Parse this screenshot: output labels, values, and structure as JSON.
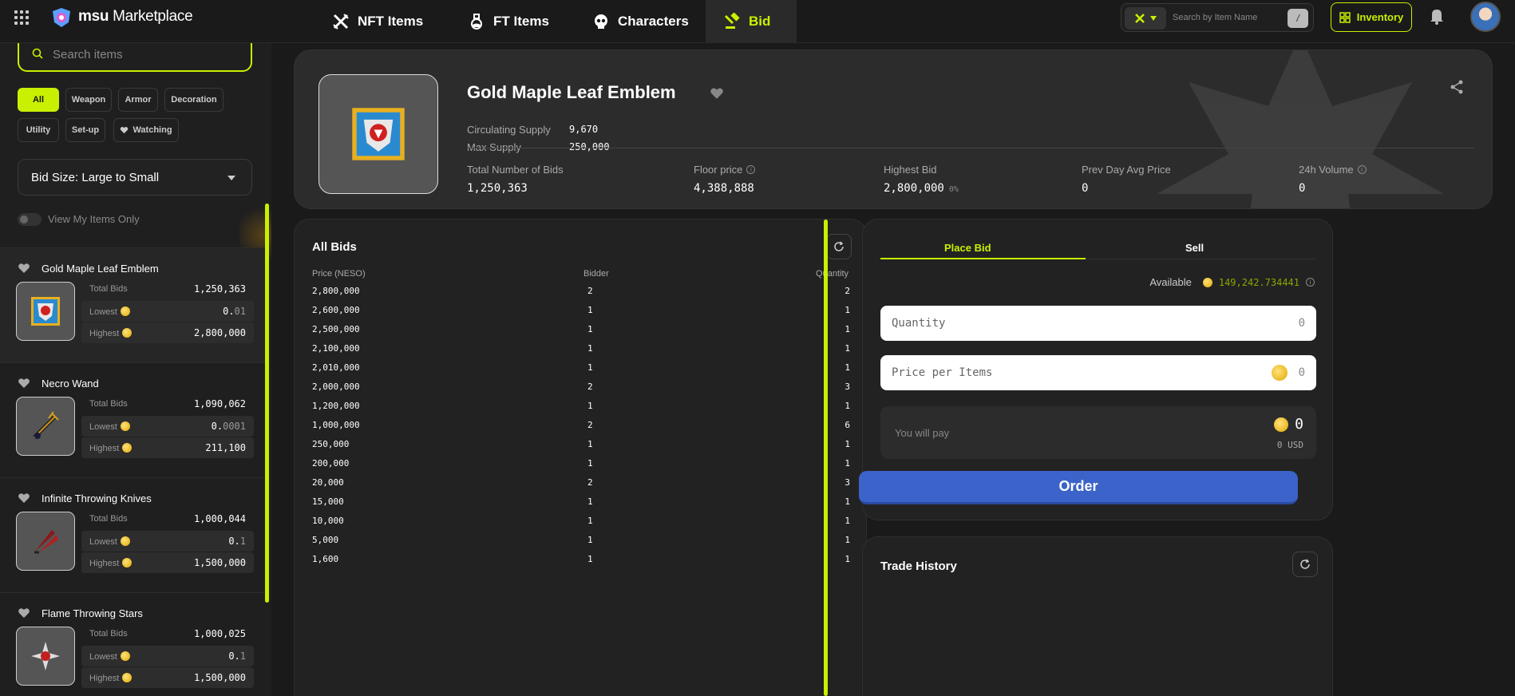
{
  "app": {
    "brand_bold": "msu",
    "brand_light": " Marketplace"
  },
  "nav": {
    "tabs": [
      {
        "label": "NFT Items",
        "icon": "crossed-swords-icon"
      },
      {
        "label": "FT Items",
        "icon": "potion-icon"
      },
      {
        "label": "Characters",
        "icon": "skull-icon"
      },
      {
        "label": "Bid",
        "icon": "bid-icon",
        "active": true
      }
    ],
    "search_placeholder": "Search by Item Name",
    "shortcut": "/",
    "inventory_label": "Inventory"
  },
  "sidebar": {
    "search_placeholder": "Search items",
    "filters": [
      "All",
      "Weapon",
      "Armor",
      "Decoration",
      "Utility",
      "Set-up",
      "Watching"
    ],
    "sort_label": "Bid Size: Large to Small",
    "toggle_label": "View My Items Only",
    "labels": {
      "total": "Total Bids",
      "lowest": "Lowest",
      "highest": "Highest"
    },
    "items": [
      {
        "name": "Gold Maple Leaf Emblem",
        "total": "1,250,363",
        "lowest_int": "0.",
        "lowest_dec": "01",
        "highest": "2,800,000"
      },
      {
        "name": "Necro Wand",
        "total": "1,090,062",
        "lowest_int": "0.",
        "lowest_dec": "0001",
        "highest": "211,100"
      },
      {
        "name": "Infinite Throwing Knives",
        "total": "1,000,044",
        "lowest_int": "0.",
        "lowest_dec": "1",
        "highest": "1,500,000"
      },
      {
        "name": "Flame Throwing Stars",
        "total": "1,000,025",
        "lowest_int": "0.",
        "lowest_dec": "1",
        "highest": "1,500,000"
      }
    ]
  },
  "detail": {
    "title": "Gold Maple Leaf Emblem",
    "circulating_label": "Circulating Supply",
    "circulating": "9,670",
    "max_label": "Max Supply",
    "max": "250,000",
    "stats": [
      {
        "label": "Total Number of Bids",
        "value": "1,250,363"
      },
      {
        "label": "Floor price",
        "value": "4,388,888",
        "info": true
      },
      {
        "label": "Highest Bid",
        "value": "2,800,000",
        "change": "0%"
      },
      {
        "label": "Prev Day Avg Price",
        "value": "0"
      },
      {
        "label": "24h Volume",
        "value": "0",
        "info": true
      }
    ]
  },
  "bids": {
    "title": "All Bids",
    "headers": {
      "price": "Price (NESO)",
      "bidder": "Bidder",
      "quantity": "Quantity"
    },
    "rows": [
      [
        "2,800,000",
        "2",
        "2"
      ],
      [
        "2,600,000",
        "1",
        "1"
      ],
      [
        "2,500,000",
        "1",
        "1"
      ],
      [
        "2,100,000",
        "1",
        "1"
      ],
      [
        "2,010,000",
        "1",
        "1"
      ],
      [
        "2,000,000",
        "2",
        "3"
      ],
      [
        "1,200,000",
        "1",
        "1"
      ],
      [
        "1,000,000",
        "2",
        "6"
      ],
      [
        "250,000",
        "1",
        "1"
      ],
      [
        "200,000",
        "1",
        "1"
      ],
      [
        "20,000",
        "2",
        "3"
      ],
      [
        "15,000",
        "1",
        "1"
      ],
      [
        "10,000",
        "1",
        "1"
      ],
      [
        "5,000",
        "1",
        "1"
      ],
      [
        "1,600",
        "1",
        "1"
      ]
    ]
  },
  "order": {
    "tab_bid": "Place Bid",
    "tab_sell": "Sell",
    "available_label": "Available",
    "available_int": "149,242.",
    "available_dec": "734441",
    "quantity_placeholder": "Quantity",
    "quantity_value": "0",
    "price_placeholder": "Price per Items",
    "price_value": "0",
    "pay_label": "You will pay",
    "pay_value": "0",
    "pay_usd": "0 USD",
    "order_label": "Order"
  },
  "trade": {
    "title": "Trade History"
  },
  "colors": {
    "accent": "#c8f000",
    "order_button": "#3b63c9"
  }
}
